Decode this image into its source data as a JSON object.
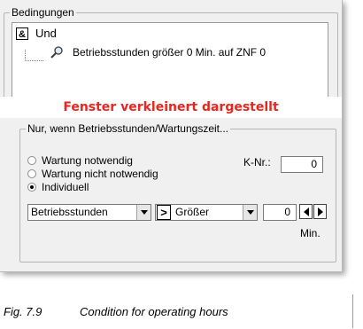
{
  "conditions": {
    "group_label": "Bedingungen",
    "tree": {
      "root_icon": "&",
      "root_label": "Und",
      "child_label": "Betriebsstunden größer  0 Min. auf ZNF 0"
    }
  },
  "banner": "Fenster verkleinert dargestellt",
  "filter": {
    "group_label": "Nur, wenn Betriebsstunden/Wartungszeit...",
    "options": [
      {
        "label": "Wartung notwendig",
        "selected": false
      },
      {
        "label": "Wartung nicht notwendig",
        "selected": false
      },
      {
        "label": "Individuell",
        "selected": true
      }
    ],
    "knr_label": "K-Nr.:",
    "knr_value": "0",
    "field_select": "Betriebsstunden",
    "operator_icon": ">",
    "operator_select": "Größer",
    "amount_value": "0",
    "unit_label": "Min."
  },
  "caption": {
    "number": "Fig. 7.9",
    "text": "Condition for operating hours"
  },
  "colors": {
    "banner_text": "#e8261f",
    "dialog_bg": "#f0f0f0"
  }
}
